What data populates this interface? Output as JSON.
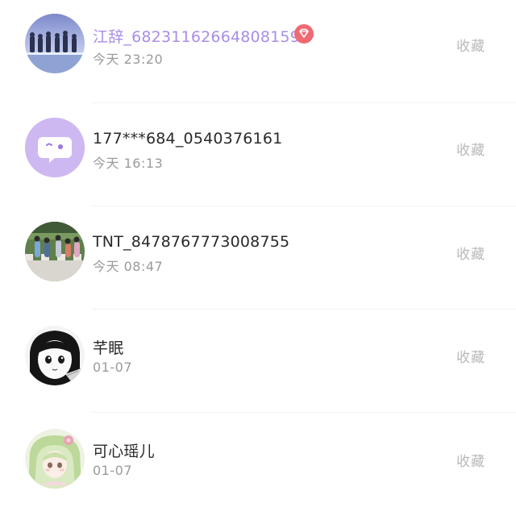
{
  "items": [
    {
      "name": "江辞_6823116266480815​9",
      "time": "今天 23:20",
      "action": "收藏",
      "vip": true
    },
    {
      "name": "177***684_0540376161",
      "time": "今天 16:13",
      "action": "收藏",
      "vip": false
    },
    {
      "name": "TNT_8478767773008755",
      "time": "今天 08:47",
      "action": "收藏",
      "vip": false
    },
    {
      "name": "芊眠",
      "time": "01-07",
      "action": "收藏",
      "vip": false
    },
    {
      "name": "可心瑶儿",
      "time": "01-07",
      "action": "收藏",
      "vip": false
    }
  ],
  "colors": {
    "vip_name": "#a98ee6",
    "vip_badge": "#f06a73",
    "chat_avatar_bg": "#cdb8f2",
    "action_text": "#b9b9b9",
    "time_text": "#9a9a9a"
  },
  "icons": {
    "vip_badge": "diamond-icon",
    "chat_avatar": "chat-bubble-icon"
  }
}
